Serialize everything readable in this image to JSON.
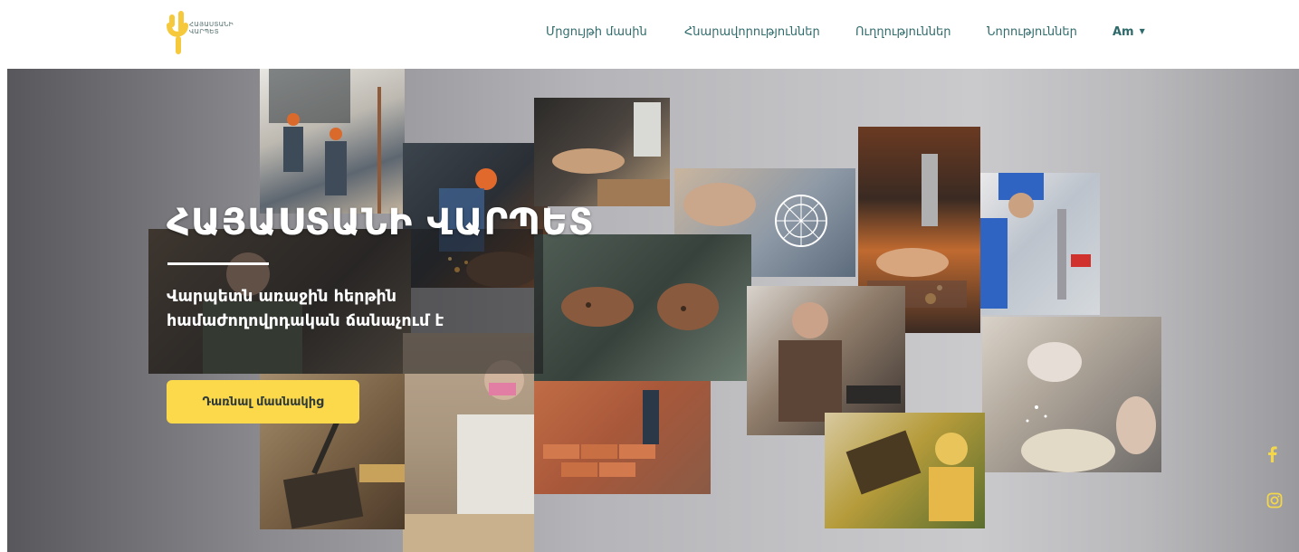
{
  "logo": {
    "line1": "ՀԱՅԱՍՏԱՆԻ",
    "line2": "ՎԱՐՊԵՏ",
    "color": "#f6c83c"
  },
  "nav": {
    "items": [
      {
        "label": "Մրցույթի մասին"
      },
      {
        "label": "Հնարավորություններ"
      },
      {
        "label": "Ուղղություններ"
      },
      {
        "label": "Նորություններ"
      }
    ],
    "language": "Am",
    "text_color": "#2f6a6b"
  },
  "hero": {
    "title": "ՀԱՅԱՍՏԱՆԻ ՎԱՐՊԵՏ",
    "subtitle": "Վարպետն առաջին հերթին համաժողովրդական ճանաչում է",
    "cta_label": "Դառնալ մասնակից",
    "cta_color": "#fcd94a"
  },
  "social": {
    "icons": [
      "facebook-icon",
      "instagram-icon"
    ],
    "color": "#f3d64a"
  }
}
